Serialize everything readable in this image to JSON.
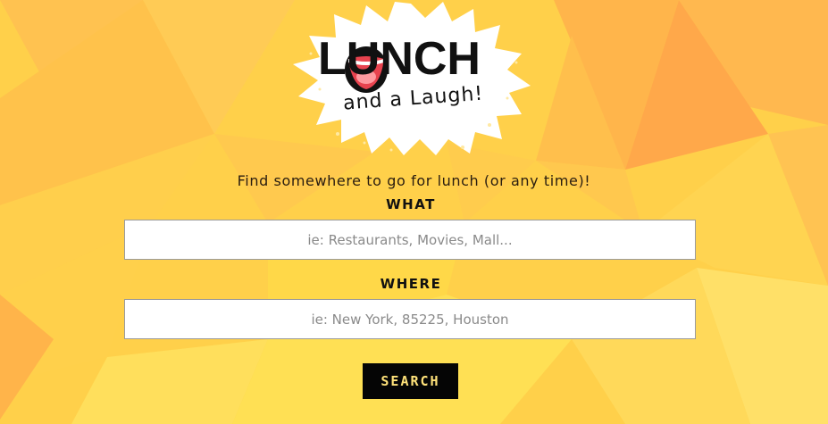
{
  "brand": {
    "logo_word": "LUNCH",
    "logo_sub": "and a Laugh!"
  },
  "tagline": "Find somewhere to go for lunch (or any time)!",
  "search": {
    "what_label": "WHAT",
    "what_placeholder": "ie: Restaurants, Movies, Mall...",
    "where_label": "WHERE",
    "where_placeholder": "ie: New York, 85225, Houston",
    "button_label": "SEARCH"
  },
  "colors": {
    "background": "#ffd24a",
    "button_bg": "#050505",
    "button_text": "#ffe27a"
  }
}
